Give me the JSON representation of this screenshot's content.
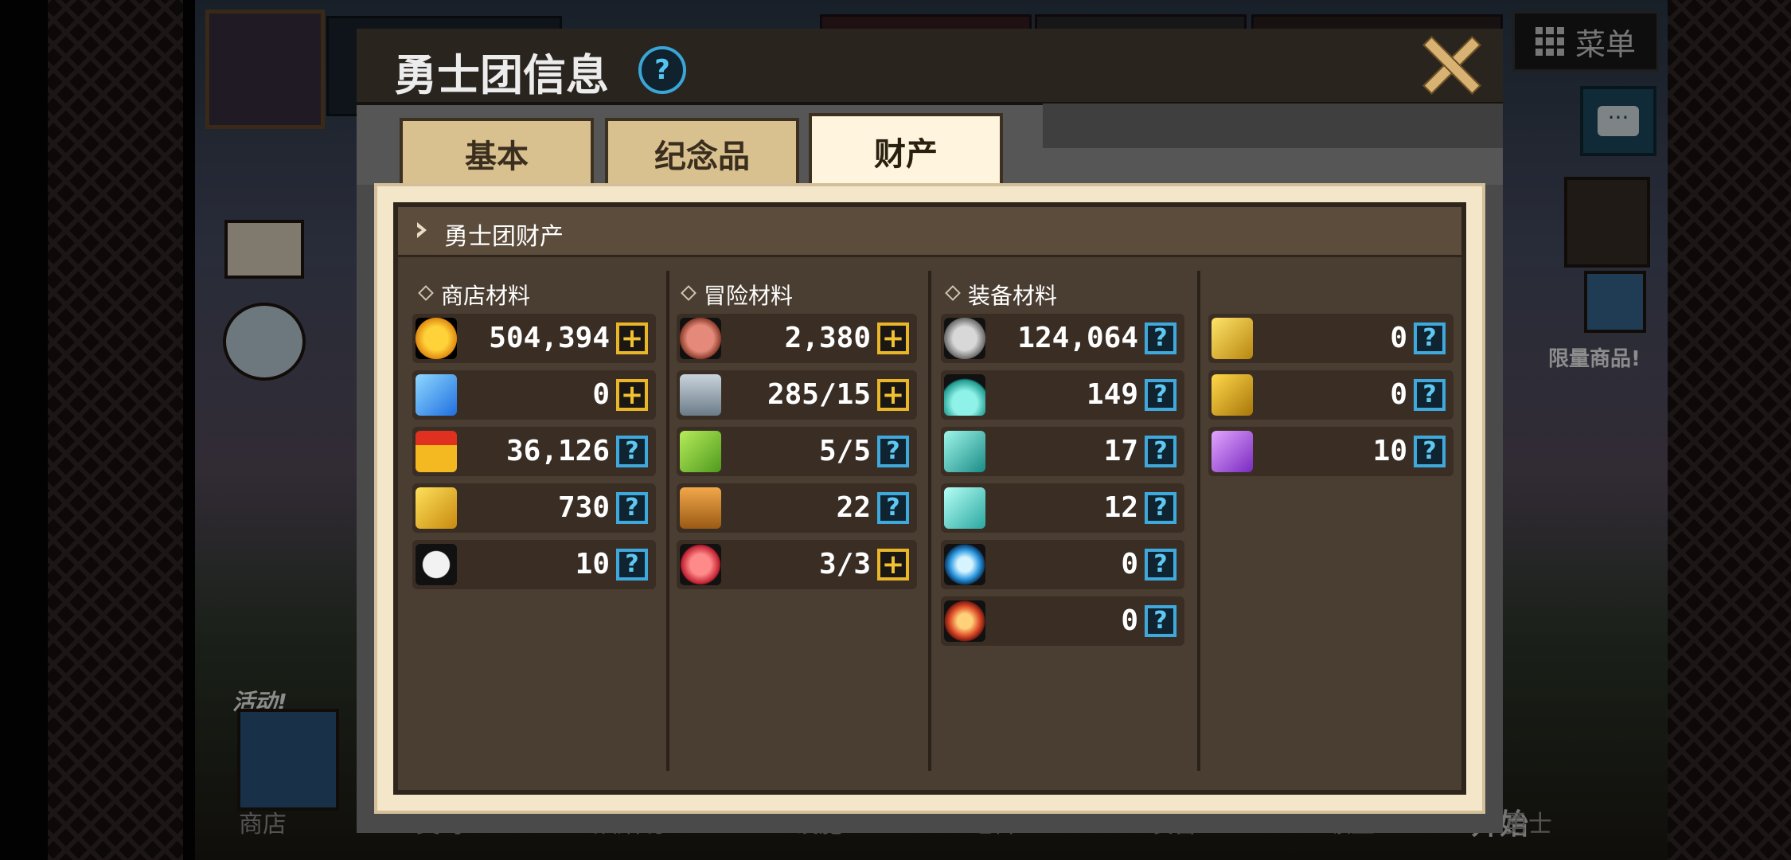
{
  "dialog": {
    "title": "勇士团信息",
    "help_glyph": "?",
    "tabs": [
      {
        "label": "基本",
        "active": false
      },
      {
        "label": "纪念品",
        "active": false
      },
      {
        "label": "财产",
        "active": true
      }
    ],
    "section_title": "勇士团财产"
  },
  "columns": {
    "shop": {
      "title": "商店材料",
      "items": [
        {
          "icon": "gold-coin-icon",
          "value": "504,394",
          "action": "plus"
        },
        {
          "icon": "blue-gem-icon",
          "value": "0",
          "action": "plus"
        },
        {
          "icon": "medal-icon",
          "value": "36,126",
          "action": "help"
        },
        {
          "icon": "gold-ticket-icon",
          "value": "730",
          "action": "help"
        },
        {
          "icon": "fish-bone-icon",
          "value": "10",
          "action": "help"
        }
      ]
    },
    "adventure": {
      "title": "冒险材料",
      "items": [
        {
          "icon": "meat-icon",
          "value": "2,380",
          "action": "plus"
        },
        {
          "icon": "key-icon",
          "value": "285/15",
          "action": "plus"
        },
        {
          "icon": "green-ticket-icon",
          "value": "5/5",
          "action": "help"
        },
        {
          "icon": "trophy-icon",
          "value": "22",
          "action": "help"
        },
        {
          "icon": "red-crystal-icon",
          "value": "3/3",
          "action": "plus"
        }
      ]
    },
    "equipment": {
      "title": "装备材料",
      "items": [
        {
          "icon": "iron-ore-icon",
          "value": "124,064",
          "action": "help"
        },
        {
          "icon": "teal-powder-icon",
          "value": "149",
          "action": "help"
        },
        {
          "icon": "teal-stone-icon",
          "value": "17",
          "action": "help"
        },
        {
          "icon": "teal-gem-icon",
          "value": "12",
          "action": "help"
        },
        {
          "icon": "blue-orb-icon",
          "value": "0",
          "action": "help"
        },
        {
          "icon": "red-orb-icon",
          "value": "0",
          "action": "help"
        }
      ]
    },
    "extra": {
      "items": [
        {
          "icon": "gold-scroll-icon",
          "value": "0",
          "action": "help"
        },
        {
          "icon": "gold-star-scroll-icon",
          "value": "0",
          "action": "help"
        },
        {
          "icon": "purple-ticket-icon",
          "value": "10",
          "action": "help"
        }
      ]
    }
  },
  "background": {
    "menu_label": "菜单",
    "limited_label": "限量商品!",
    "event_label": "活动!",
    "start_label": "开始",
    "bottom_nav": [
      "商店",
      "契约",
      "烘焙坊",
      "设施",
      "仓库",
      "装备",
      "领主",
      "勇士"
    ]
  },
  "colors": {
    "plus_accent": "#e9b629",
    "help_accent": "#3fa9dd",
    "panel_bg": "#4a3d31",
    "tab_active": "#fff4de",
    "tab_inactive": "#d9c08f"
  }
}
